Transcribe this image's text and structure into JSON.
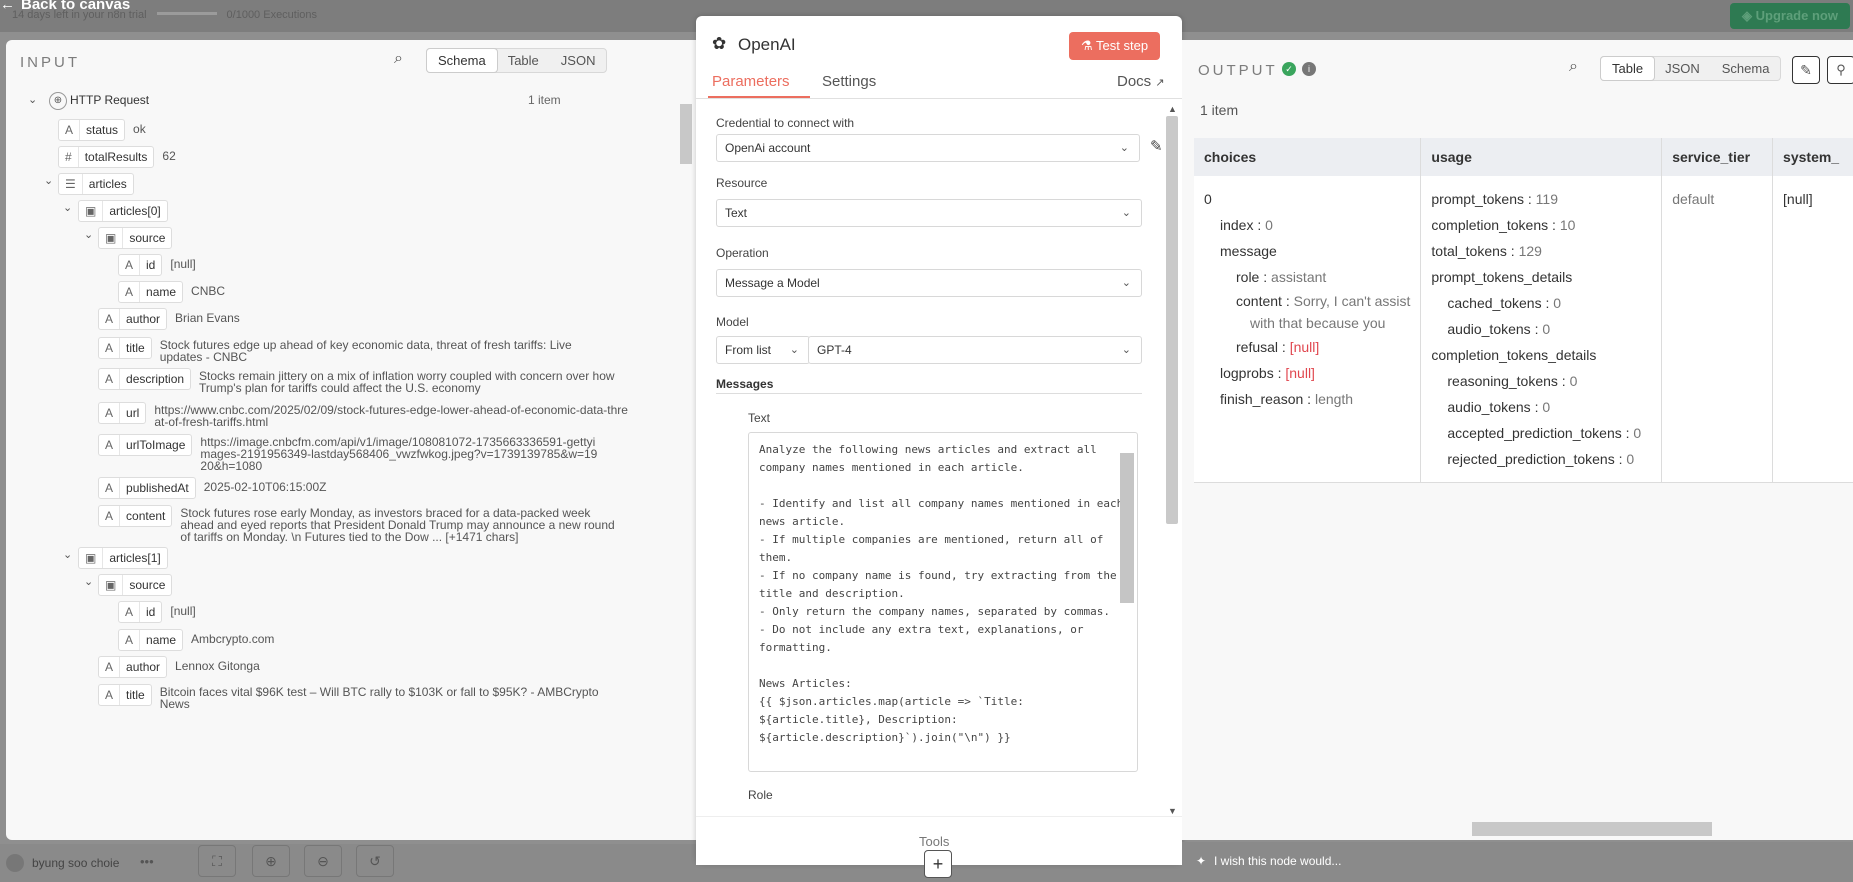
{
  "topbar": {
    "back_label": "Back to canvas",
    "trial_text": "14 days left in your n8n trial",
    "executions": "0/1000 Executions",
    "upgrade_label": "Upgrade now"
  },
  "input": {
    "title": "INPUT",
    "views": [
      "Schema",
      "Table",
      "JSON"
    ],
    "node_name": "HTTP Request",
    "item_count": "1 item",
    "fields": {
      "status": {
        "key": "status",
        "type": "A",
        "value": "ok"
      },
      "totalResults": {
        "key": "totalResults",
        "type": "#",
        "value": "62"
      },
      "articles": "articles",
      "a0": "articles[0]",
      "source": "source",
      "id0": {
        "key": "id",
        "value": "[null]"
      },
      "name0": {
        "key": "name",
        "value": "CNBC"
      },
      "author0": {
        "key": "author",
        "value": "Brian Evans"
      },
      "title0": {
        "key": "title",
        "value": "Stock futures edge up ahead of key economic data, threat of fresh tariffs: Live updates - CNBC"
      },
      "desc0": {
        "key": "description",
        "value": "Stocks remain jittery on a mix of inflation worry coupled with concern over how Trump's plan for tariffs could affect the U.S. economy"
      },
      "url0": {
        "key": "url",
        "value": "https://www.cnbc.com/2025/02/09/stock-futures-edge-lower-ahead-of-economic-data-threat-of-fresh-tariffs.html"
      },
      "urlimg0": {
        "key": "urlToImage",
        "value": "https://image.cnbcfm.com/api/v1/image/108081072-1735663336591-gettyimages-2191956349-lastday568406_vwzfwkog.jpeg?v=1739139785&w=1920&h=1080"
      },
      "pub0": {
        "key": "publishedAt",
        "value": "2025-02-10T06:15:00Z"
      },
      "content0": {
        "key": "content",
        "value": "Stock futures rose early Monday, as investors braced for a data-packed week ahead and eyed reports that President Donald Trump may announce a new round of tariffs on Monday. \\n Futures tied to the Dow ... [+1471 chars]"
      },
      "a1": "articles[1]",
      "id1": {
        "key": "id",
        "value": "[null]"
      },
      "name1": {
        "key": "name",
        "value": "Ambcrypto.com"
      },
      "author1": {
        "key": "author",
        "value": "Lennox Gitonga"
      },
      "title1": {
        "key": "title",
        "value": "Bitcoin faces vital $96K test – Will BTC rally to $103K or fall to $95K? - AMBCrypto News"
      }
    }
  },
  "node": {
    "name": "OpenAI",
    "test_label": "Test step",
    "tabs": [
      "Parameters",
      "Settings"
    ],
    "docs": "Docs",
    "credential_label": "Credential to connect with",
    "credential_value": "OpenAi account",
    "resource_label": "Resource",
    "resource_value": "Text",
    "operation_label": "Operation",
    "operation_value": "Message a Model",
    "model_label": "Model",
    "model_mode": "From list",
    "model_value": "GPT-4",
    "messages_label": "Messages",
    "text_label": "Text",
    "text_value": "Analyze the following news articles and extract all\ncompany names mentioned in each article.\n\n- Identify and list all company names mentioned in each\nnews article.\n- If multiple companies are mentioned, return all of\nthem.\n- If no company name is found, try extracting from the\ntitle and description.\n- Only return the company names, separated by commas.\n- Do not include any extra text, explanations, or\nformatting.\n\nNews Articles:\n{{ $json.articles.map(article => `Title:\n${article.title}, Description:\n${article.description}`).join(\"\\n\") }}",
    "role_label": "Role",
    "tools_label": "Tools"
  },
  "output": {
    "title": "OUTPUT",
    "views": [
      "Table",
      "JSON",
      "Schema"
    ],
    "item_count": "1 item",
    "columns": [
      "choices",
      "usage",
      "service_tier",
      "system_"
    ],
    "choices": {
      "index_label": "0",
      "index": {
        "k": "index",
        "v": "0"
      },
      "message": "message",
      "role": {
        "k": "role",
        "v": "assistant"
      },
      "content": {
        "k": "content",
        "v": "Sorry, I can't assist",
        "v2": "with that because you"
      },
      "refusal": {
        "k": "refusal",
        "v": "[null]"
      },
      "logprobs": {
        "k": "logprobs",
        "v": "[null]"
      },
      "finish_reason": {
        "k": "finish_reason",
        "v": "length"
      }
    },
    "usage": {
      "prompt_tokens": {
        "k": "prompt_tokens",
        "v": "119"
      },
      "completion_tokens": {
        "k": "completion_tokens",
        "v": "10"
      },
      "total_tokens": {
        "k": "total_tokens",
        "v": "129"
      },
      "ptd": "prompt_tokens_details",
      "cached_tokens": {
        "k": "cached_tokens",
        "v": "0"
      },
      "audio_tokens": {
        "k": "audio_tokens",
        "v": "0"
      },
      "ctd": "completion_tokens_details",
      "reasoning_tokens": {
        "k": "reasoning_tokens",
        "v": "0"
      },
      "audio_tokens2": {
        "k": "audio_tokens",
        "v": "0"
      },
      "accepted": {
        "k": "accepted_prediction_tokens",
        "v": "0"
      },
      "rejected": {
        "k": "rejected_prediction_tokens",
        "v": "0"
      }
    },
    "service_tier": "default",
    "system_fingerprint": "[null]",
    "feedback": "I wish this node would..."
  },
  "footer": {
    "user": "byung soo choie"
  }
}
